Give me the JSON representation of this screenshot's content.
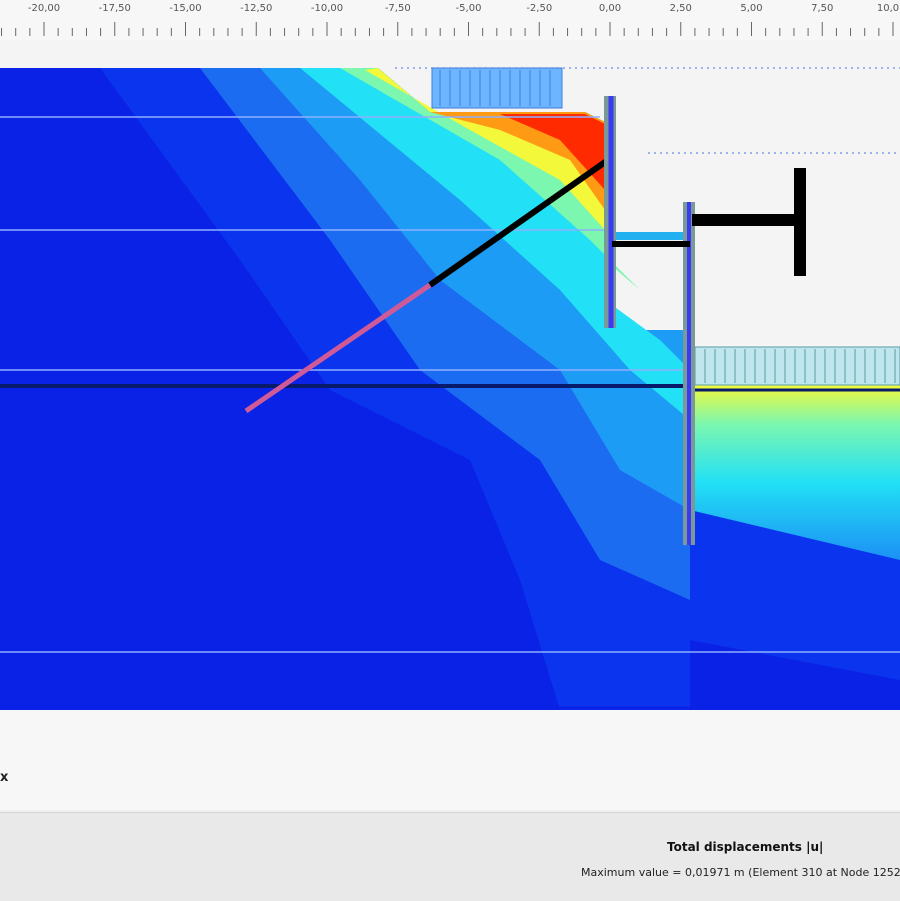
{
  "ruler": {
    "ticks": [
      {
        "value": -20,
        "label": "-20,00"
      },
      {
        "value": -17.5,
        "label": "-17,50"
      },
      {
        "value": -15,
        "label": "-15,00"
      },
      {
        "value": -12.5,
        "label": "-12,50"
      },
      {
        "value": -10,
        "label": "-10,00"
      },
      {
        "value": -7.5,
        "label": "-7,50"
      },
      {
        "value": -5,
        "label": "-5,00"
      },
      {
        "value": -2.5,
        "label": "-2,50"
      },
      {
        "value": 0,
        "label": "0,00"
      },
      {
        "value": 2.5,
        "label": "2,50"
      },
      {
        "value": 5,
        "label": "5,00"
      },
      {
        "value": 7.5,
        "label": "7,50"
      },
      {
        "value": 10,
        "label": "10,0"
      }
    ]
  },
  "axis": {
    "x_label": "x"
  },
  "result": {
    "title": "Total displacements |u|",
    "max_value_text": "Maximum value = 0,01971 m (Element 310 at Node 1252"
  },
  "colors": {
    "contour_low": "#0a22e6",
    "contour_mid": "#00ffff",
    "contour_high": "#ff2a00",
    "wall": "#3a3af0",
    "anchor_free": "#000000",
    "anchor_grout": "#d05a98",
    "strut": "#000000",
    "water_line": "#0a1a6a"
  }
}
